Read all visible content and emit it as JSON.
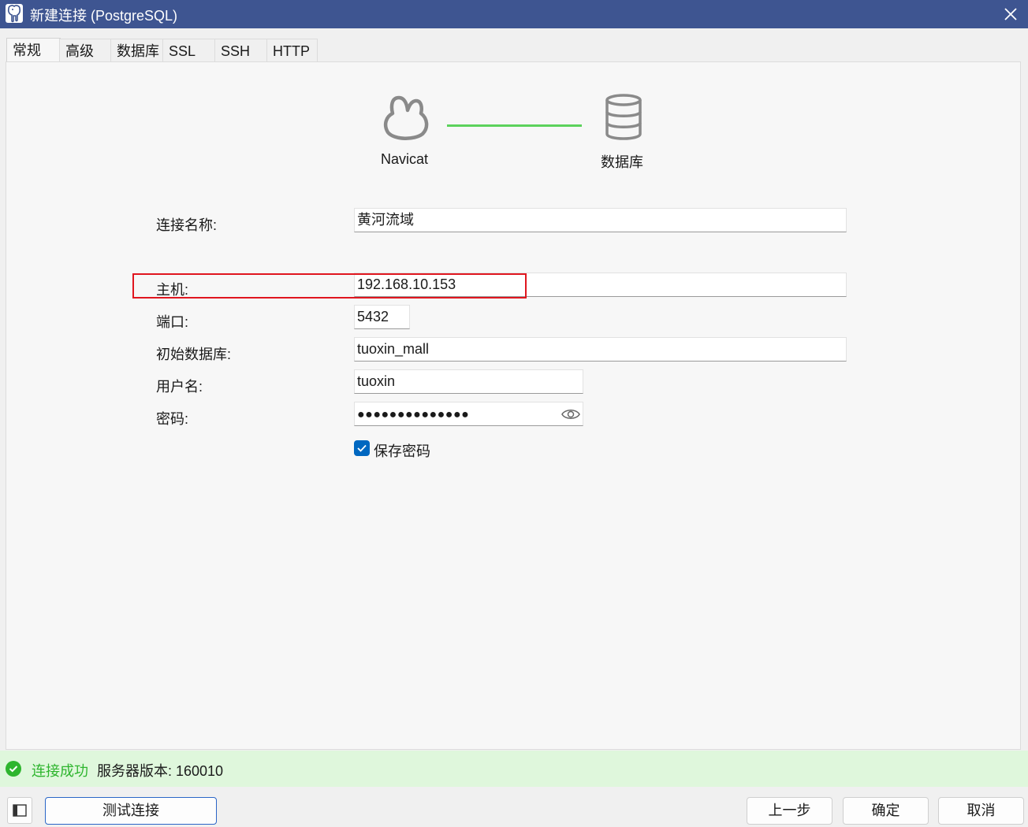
{
  "window": {
    "title": "新建连接 (PostgreSQL)",
    "app_icon": "postgresql-elephant-icon",
    "close_icon": "close-icon"
  },
  "tabs": [
    {
      "label": "常规",
      "active": true
    },
    {
      "label": "高级",
      "active": false
    },
    {
      "label": "数据库",
      "active": false
    },
    {
      "label": "SSL",
      "active": false
    },
    {
      "label": "SSH",
      "active": false
    },
    {
      "label": "HTTP",
      "active": false
    }
  ],
  "diagram": {
    "left_icon": "navicat-logo-icon",
    "left_label": "Navicat",
    "right_icon": "database-icon",
    "right_label": "数据库",
    "connector_color": "#5cd25c"
  },
  "form": {
    "connection_name": {
      "label": "连接名称:",
      "value": "黄河流域"
    },
    "host": {
      "label": "主机:",
      "value": "192.168.10.153"
    },
    "port": {
      "label": "端口:",
      "value": "5432"
    },
    "initial_database": {
      "label": "初始数据库:",
      "value": "tuoxin_mall"
    },
    "username": {
      "label": "用户名:",
      "value": "tuoxin"
    },
    "password": {
      "label": "密码:",
      "value": "●●●●●●●●●●●●●●",
      "reveal_icon": "eye-icon"
    },
    "save_password": {
      "label": "保存密码",
      "checked": true
    }
  },
  "annotation": {
    "highlight_color": "#e0161f"
  },
  "status": {
    "icon": "check-circle-icon",
    "message": "连接成功",
    "version": "服务器版本: 160010",
    "color": "#2eb52e"
  },
  "buttons": {
    "panel_toggle_icon": "sidebar-toggle-icon",
    "test": "测试连接",
    "back": "上一步",
    "ok": "确定",
    "cancel": "取消"
  }
}
